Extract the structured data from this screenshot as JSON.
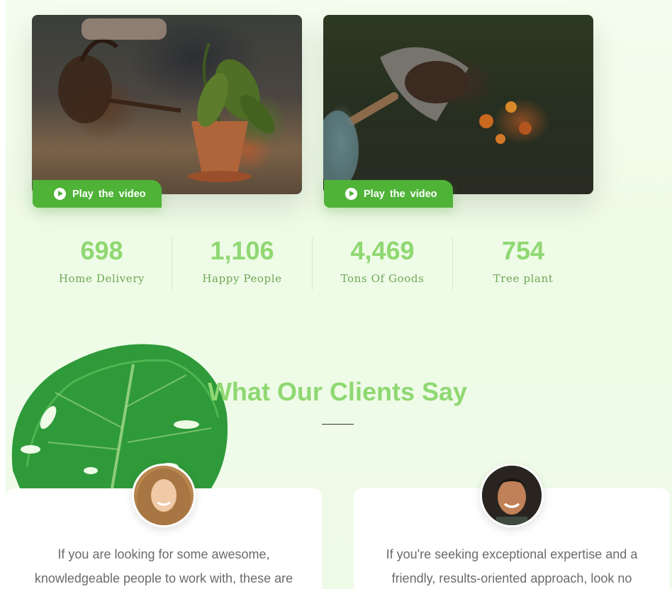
{
  "videos": [
    {
      "button_label": "Play the video",
      "image": "watering-plant-photo"
    },
    {
      "button_label": "Play the video",
      "image": "shovel-soil-photo"
    }
  ],
  "stats": [
    {
      "value": "698",
      "label": "Home Delivery"
    },
    {
      "value": "1,106",
      "label": "Happy People"
    },
    {
      "value": "4,469",
      "label": "Tons Of Goods"
    },
    {
      "value": "754",
      "label": "Tree plant"
    }
  ],
  "testimonials": {
    "title": "What Our Clients Say",
    "items": [
      {
        "text": "If you are looking for some awesome, knowledgeable people to work with, these are",
        "avatar": "woman-avatar"
      },
      {
        "text": "If you're seeking exceptional expertise and a friendly, results-oriented approach, look no",
        "avatar": "man-avatar"
      }
    ]
  },
  "colors": {
    "accent_green": "#4fb338",
    "light_green_text": "#8fd872",
    "label_green": "#6fa756",
    "page_background": "#effbe9"
  }
}
